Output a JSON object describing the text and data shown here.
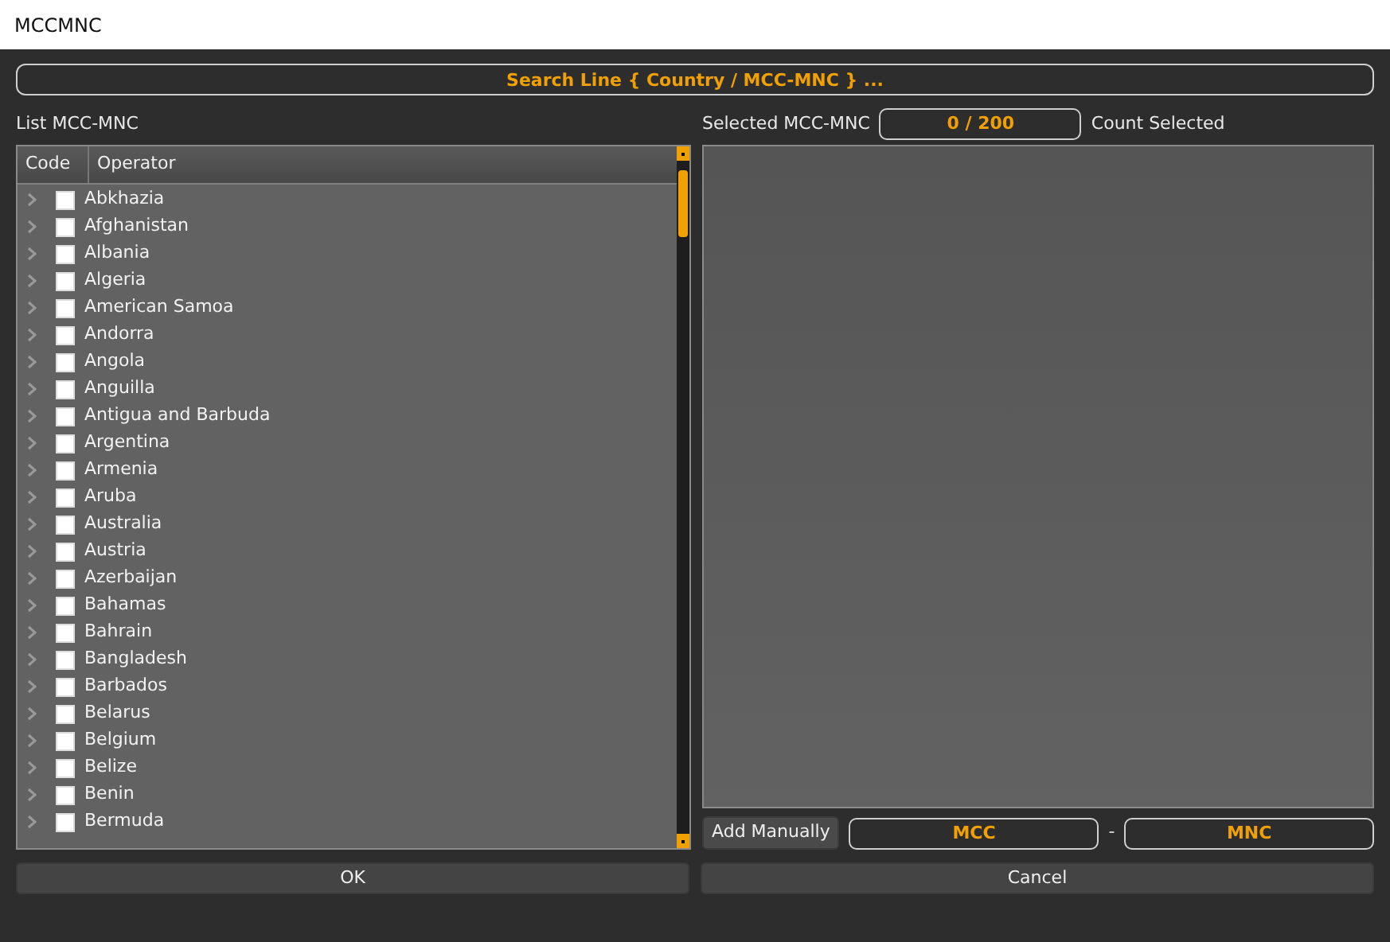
{
  "window": {
    "title": "MCCMNC"
  },
  "search": {
    "placeholder": "Search Line { Country / MCC-MNC } ..."
  },
  "list_label": "List MCC-MNC",
  "selected_label": "Selected MCC-MNC",
  "count": {
    "value": "0 / 200",
    "label": "Count Selected"
  },
  "tree": {
    "columns": [
      "Code",
      "Operator"
    ],
    "rows": [
      {
        "name": "Abkhazia",
        "checked": false
      },
      {
        "name": "Afghanistan",
        "checked": false
      },
      {
        "name": "Albania",
        "checked": false
      },
      {
        "name": "Algeria",
        "checked": false
      },
      {
        "name": "American Samoa",
        "checked": false
      },
      {
        "name": "Andorra",
        "checked": false
      },
      {
        "name": "Angola",
        "checked": false
      },
      {
        "name": "Anguilla",
        "checked": false
      },
      {
        "name": "Antigua and Barbuda",
        "checked": false
      },
      {
        "name": "Argentina",
        "checked": false
      },
      {
        "name": "Armenia",
        "checked": false
      },
      {
        "name": "Aruba",
        "checked": false
      },
      {
        "name": "Australia",
        "checked": false
      },
      {
        "name": "Austria",
        "checked": false
      },
      {
        "name": "Azerbaijan",
        "checked": false
      },
      {
        "name": "Bahamas",
        "checked": false
      },
      {
        "name": "Bahrain",
        "checked": false
      },
      {
        "name": "Bangladesh",
        "checked": false
      },
      {
        "name": "Barbados",
        "checked": false
      },
      {
        "name": "Belarus",
        "checked": false
      },
      {
        "name": "Belgium",
        "checked": false
      },
      {
        "name": "Belize",
        "checked": false
      },
      {
        "name": "Benin",
        "checked": false
      },
      {
        "name": "Bermuda",
        "checked": false
      }
    ]
  },
  "add_manually": {
    "button": "Add Manually",
    "mcc_placeholder": "MCC",
    "separator": "-",
    "mnc_placeholder": "MNC"
  },
  "buttons": [
    "OK",
    "Cancel"
  ]
}
